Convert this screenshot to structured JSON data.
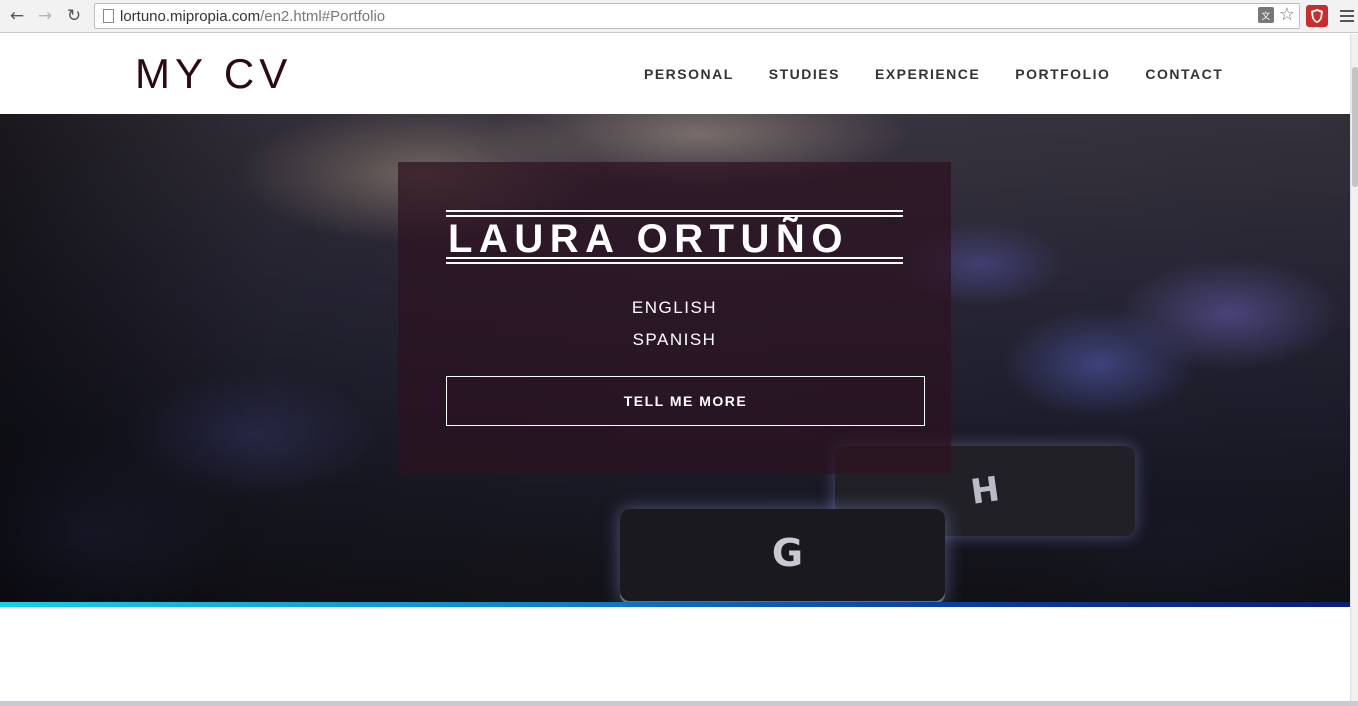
{
  "browser": {
    "back_icon": "back-arrow-icon",
    "forward_icon": "forward-arrow-icon",
    "reload_icon": "reload-icon",
    "url_host": "lortuno.mipropia.com",
    "url_path": "/en2.html#Portfolio"
  },
  "header": {
    "logo": "MY CV",
    "nav": [
      {
        "label": "PERSONAL"
      },
      {
        "label": "STUDIES"
      },
      {
        "label": "EXPERIENCE"
      },
      {
        "label": "PORTFOLIO"
      },
      {
        "label": "CONTACT"
      }
    ]
  },
  "hero": {
    "name": "LAURA ORTUÑO",
    "languages": [
      "ENGLISH",
      "SPANISH"
    ],
    "cta_label": "TELL ME MORE",
    "key_g": "G",
    "key_h": "H"
  },
  "colors": {
    "logo": "#2b0a14",
    "box": "#2d1220",
    "bar_start": "#16d0e6",
    "bar_end": "#0a1d7a"
  }
}
